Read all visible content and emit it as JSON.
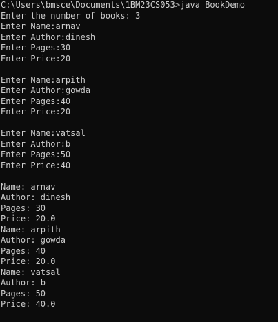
{
  "console": {
    "text_color": "#cccccc",
    "background_color": "#0c0c0c",
    "lines": [
      "C:\\Users\\bmsce\\Documents\\1BM23CS053>java BookDemo",
      "Enter the number of books: 3",
      "Enter Name:arnav",
      "Enter Author:dinesh",
      "Enter Pages:30",
      "Enter Price:20",
      "",
      "Enter Name:arpith",
      "Enter Author:gowda",
      "Enter Pages:40",
      "Enter Price:20",
      "",
      "Enter Name:vatsal",
      "Enter Author:b",
      "Enter Pages:50",
      "Enter Price:40",
      "",
      "Name: arnav",
      "Author: dinesh",
      "Pages: 30",
      "Price: 20.0",
      "Name: arpith",
      "Author: gowda",
      "Pages: 40",
      "Price: 20.0",
      "Name: vatsal",
      "Author: b",
      "Pages: 50",
      "Price: 40.0"
    ]
  }
}
